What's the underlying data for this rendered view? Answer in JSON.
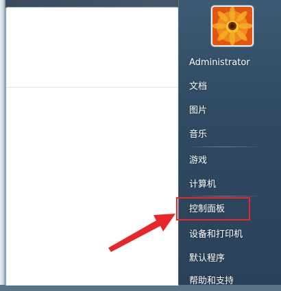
{
  "user": {
    "name": "Administrator"
  },
  "menu": {
    "items": [
      {
        "label": "文档"
      },
      {
        "label": "图片"
      },
      {
        "label": "音乐"
      },
      {
        "label": "游戏"
      },
      {
        "label": "计算机"
      },
      {
        "label": "控制面板"
      },
      {
        "label": "设备和打印机"
      },
      {
        "label": "默认程序"
      },
      {
        "label": "帮助和支持"
      }
    ],
    "highlighted_item": "控制面板"
  },
  "annotation": {
    "color": "#e8262a",
    "icon": "red-arrow-icon"
  },
  "colors": {
    "panel": "#2f4a62",
    "left_pane": "#ffffff",
    "text": "#ffffff"
  },
  "icons": {
    "avatar": "flower-avatar-icon"
  }
}
